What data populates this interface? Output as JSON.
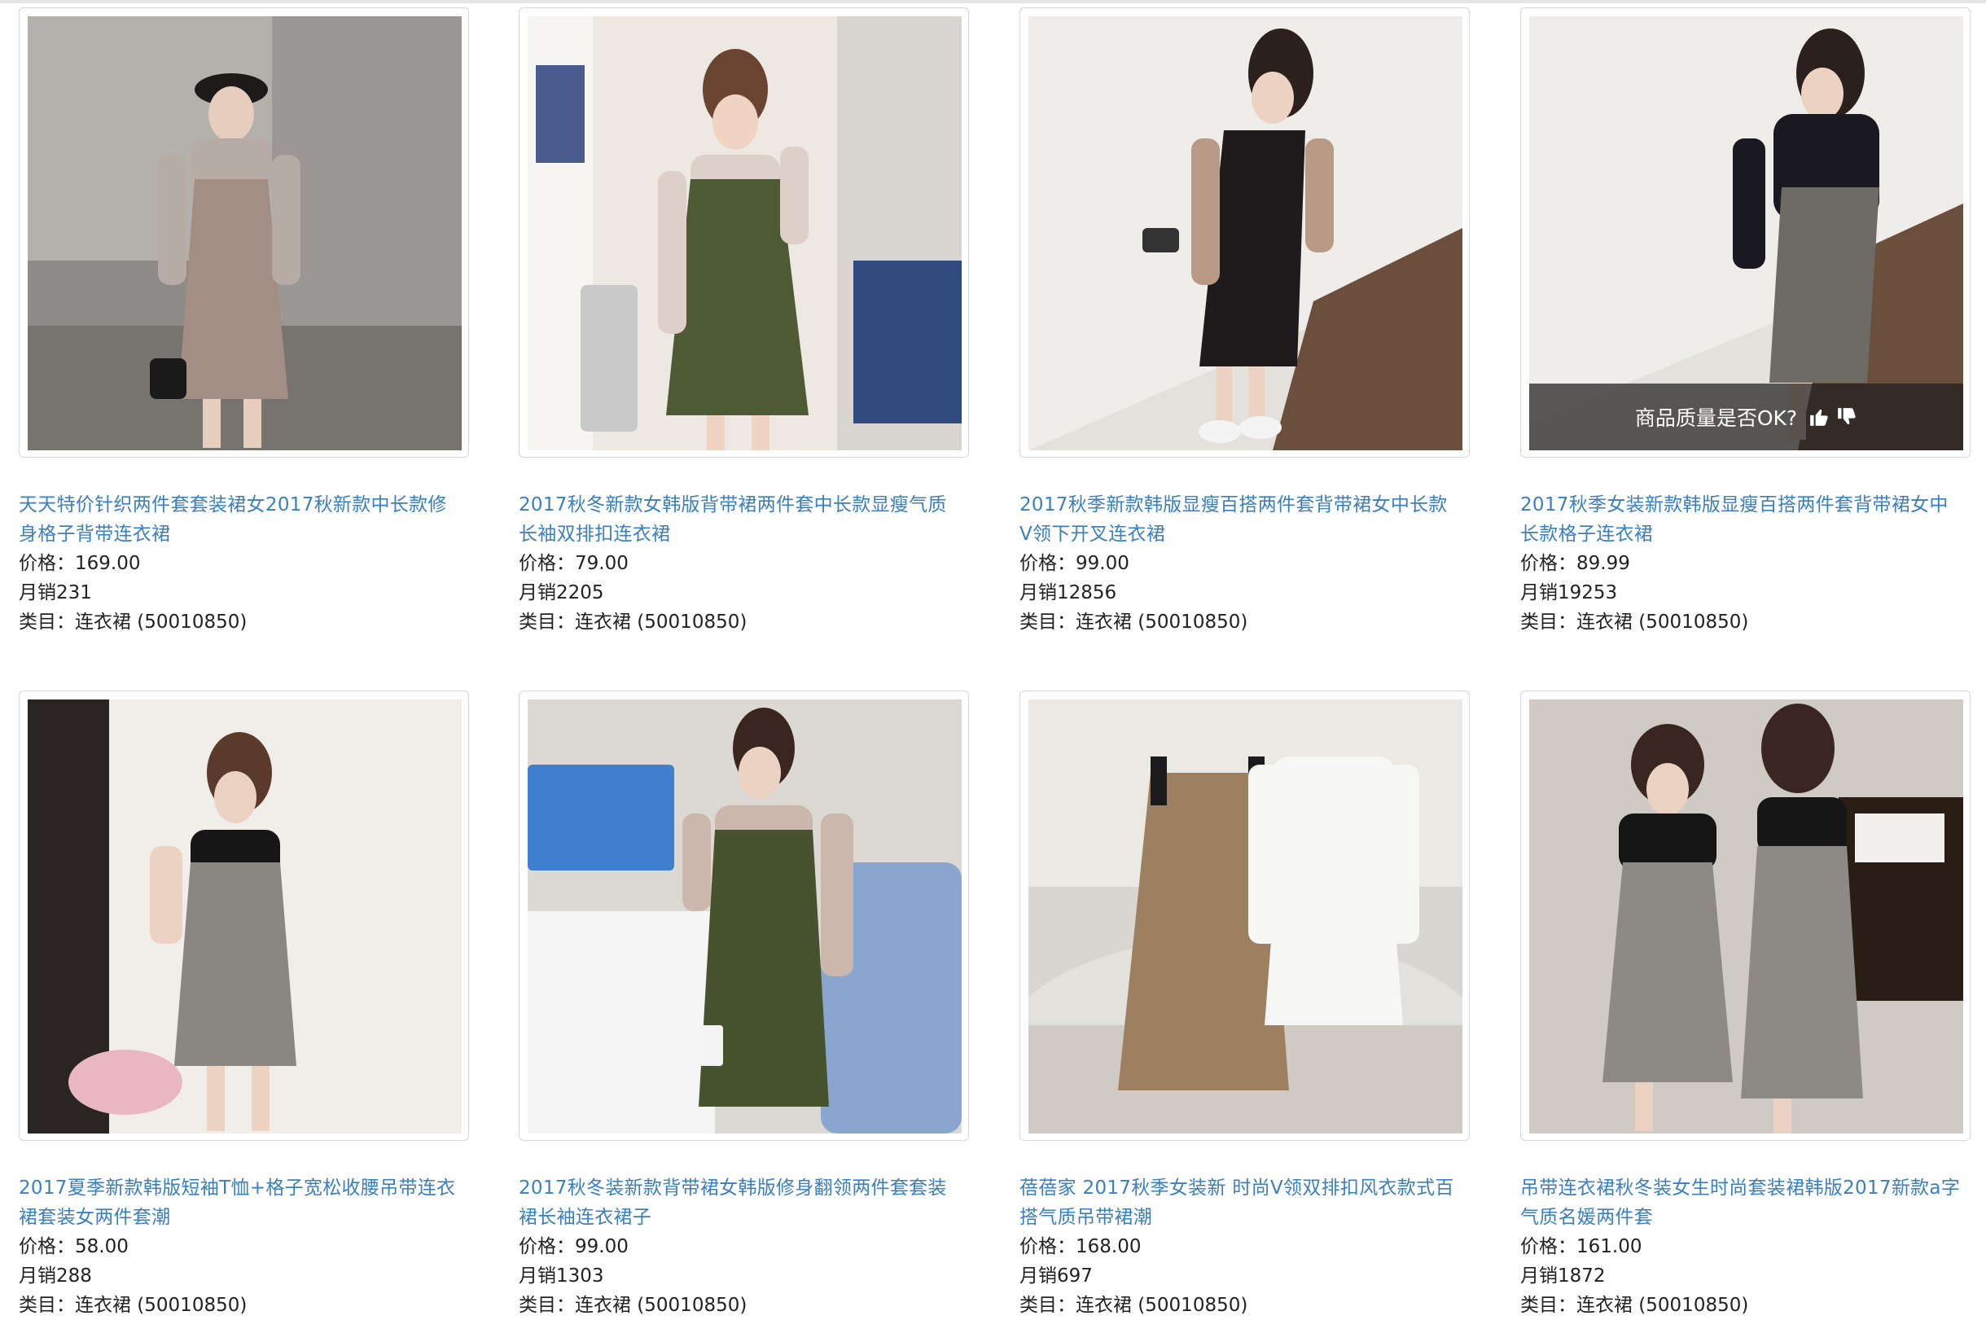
{
  "labels": {
    "price_prefix": "价格：",
    "sales_prefix": "月销",
    "category_prefix": "类目：",
    "quality_question": "商品质量是否OK?"
  },
  "products": [
    {
      "title_line1": "天天特价针织两件套套装裙女2017秋新款中长款修",
      "title_line2": "身格子背带连衣裙",
      "price": "169.00",
      "sales": "231",
      "category": "连衣裙 (50010850)"
    },
    {
      "title_line1": "2017秋冬新款女韩版背带裙两件套中长款显瘦气质",
      "title_line2": "长袖双排扣连衣裙",
      "price": "79.00",
      "sales": "2205",
      "category": "连衣裙 (50010850)"
    },
    {
      "title_line1": "2017秋季新款韩版显瘦百搭两件套背带裙女中长款",
      "title_line2": "V领下开叉连衣裙",
      "price": "99.00",
      "sales": "12856",
      "category": "连衣裙 (50010850)"
    },
    {
      "title_line1": "2017秋季女装新款韩版显瘦百搭两件套背带裙女中",
      "title_line2": "长款格子连衣裙",
      "price": "89.99",
      "sales": "19253",
      "category": "连衣裙 (50010850)"
    },
    {
      "title_line1": "2017夏季新款韩版短袖T恤+格子宽松收腰吊带连衣",
      "title_line2": "裙套装女两件套潮",
      "price": "58.00",
      "sales": "288",
      "category": "连衣裙 (50010850)"
    },
    {
      "title_line1": "2017秋冬装新款背带裙女韩版修身翻领两件套套装",
      "title_line2": "裙长袖连衣裙子",
      "price": "99.00",
      "sales": "1303",
      "category": "连衣裙 (50010850)"
    },
    {
      "title_line1": "蓓蓓家 2017秋季女装新 时尚V领双排扣风衣款式百",
      "title_line2": "搭气质吊带裙潮",
      "price": "168.00",
      "sales": "697",
      "category": "连衣裙 (50010850)"
    },
    {
      "title_line1": "吊带连衣裙秋冬装女生时尚套装裙韩版2017新款a字",
      "title_line2": "气质名媛两件套",
      "price": "161.00",
      "sales": "1872",
      "category": "连衣裙 (50010850)"
    }
  ],
  "colors": {
    "link": "#3a7fc0",
    "text": "#222222",
    "border": "#d6d6d6"
  },
  "icons": [
    "thumbs-up-icon",
    "thumbs-down-icon"
  ]
}
